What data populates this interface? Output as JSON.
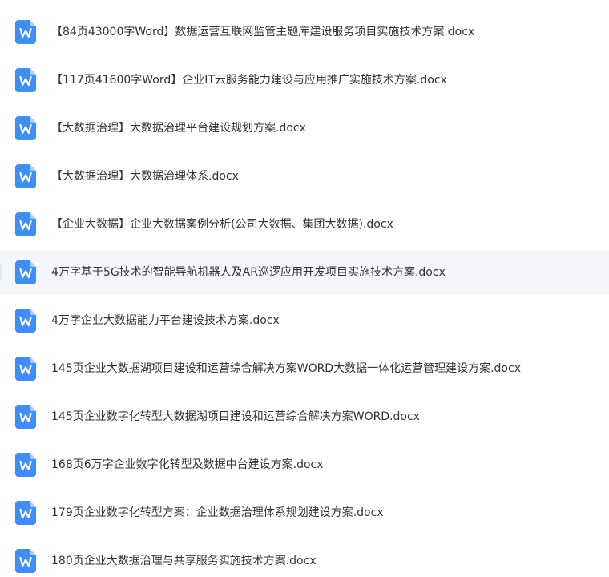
{
  "colors": {
    "icon_blue": "#3f8ef6",
    "icon_fold": "#a9ccfb",
    "text": "#333333",
    "hover_bg": "#f5f6fa"
  },
  "icon": "word-doc-icon",
  "files": [
    {
      "name": "【84页43000字Word】数据运营互联网监管主题库建设服务项目实施技术方案.docx"
    },
    {
      "name": "【117页41600字Word】企业IT云服务能力建设与应用推广实施技术方案.docx"
    },
    {
      "name": "【大数据治理】大数据治理平台建设规划方案.docx"
    },
    {
      "name": "【大数据治理】大数据治理体系.docx"
    },
    {
      "name": "【企业大数据】企业大数据案例分析(公司大数据、集团大数据).docx"
    },
    {
      "name": "4万字基于5G技术的智能导航机器人及AR巡逻应用开发项目实施技术方案.docx",
      "hovered": true
    },
    {
      "name": "4万字企业大数据能力平台建设技术方案.docx"
    },
    {
      "name": "145页企业大数据湖项目建设和运营综合解决方案WORD大数据一体化运营管理建设方案.docx"
    },
    {
      "name": "145页企业数字化转型大数据湖项目建设和运营综合解决方案WORD.docx"
    },
    {
      "name": "168页6万字企业数字化转型及数据中台建设方案.docx"
    },
    {
      "name": "179页企业数字化转型方案：企业数据治理体系规划建设方案.docx"
    },
    {
      "name": "180页企业大数据治理与共享服务实施技术方案.docx"
    }
  ]
}
